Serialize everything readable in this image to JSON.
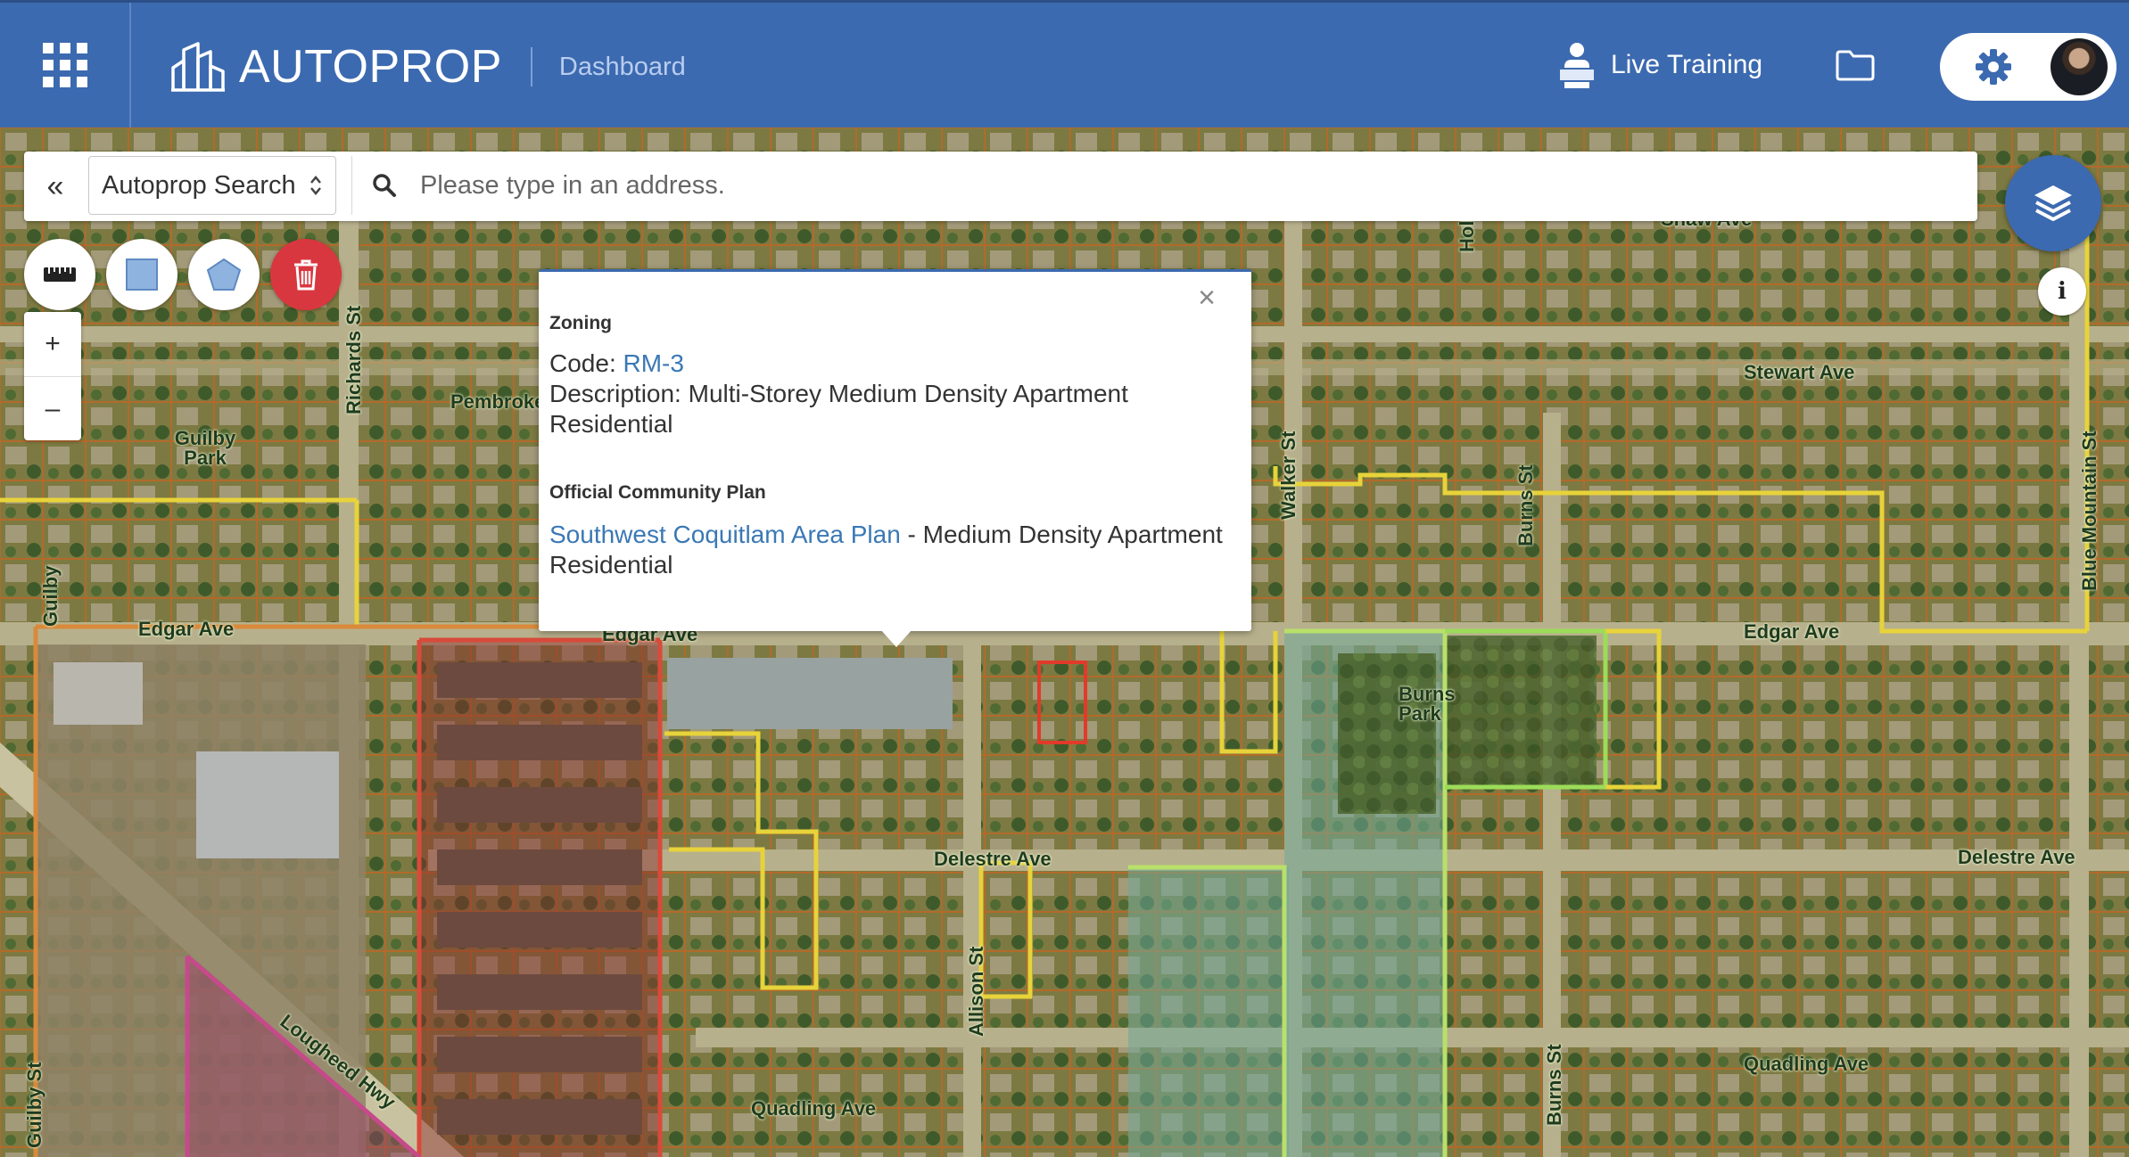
{
  "header": {
    "brand": "AUTOPROP",
    "section": "Dashboard",
    "live_training": "Live Training"
  },
  "search": {
    "collapse_glyph": "«",
    "mode": "Autoprop Search",
    "placeholder": "Please type in an address."
  },
  "map_controls": {
    "zoom_in": "+",
    "zoom_out": "–",
    "info": "i"
  },
  "popup": {
    "close": "×",
    "zoning_heading": "Zoning",
    "code_label": "Code: ",
    "code_value": "RM-3",
    "description_label": "Description: ",
    "description_value": "Multi-Storey Medium Density Apartment Residential",
    "ocp_heading": "Official Community Plan",
    "ocp_link": "Southwest Coquitlam Area Plan",
    "ocp_value": " - Medium Density Apartment Residential"
  },
  "streets": {
    "shaw": "Shaw Ave",
    "holborn": "Holborn St",
    "stewart": "Stewart Ave",
    "walker": "Walker St",
    "burns": "Burns St",
    "blue_mountain": "Blue Mountain St",
    "edgar_left": "Edgar Ave",
    "edgar_mid": "Edgar Ave",
    "edgar_right": "Edgar Ave",
    "pembroke": "Pembroke",
    "richards": "Richards St",
    "guilby_park": "Guilby Park",
    "guilby_st_top": "Guilby",
    "guilby_st_bottom": "Guilby St",
    "burns_park": "Burns Park",
    "delestre_mid": "Delestre Ave",
    "delestre_right": "Delestre Ave",
    "allison": "Allison St",
    "lougheed": "Lougheed Hwy",
    "quadling_left": "Quadling Ave",
    "quadling_right": "Quadling Ave",
    "burns_bottom": "Burns St"
  },
  "colors": {
    "header_blue": "#3c6ab0",
    "link_blue": "#3a78b5",
    "delete_red": "#d9373f"
  }
}
